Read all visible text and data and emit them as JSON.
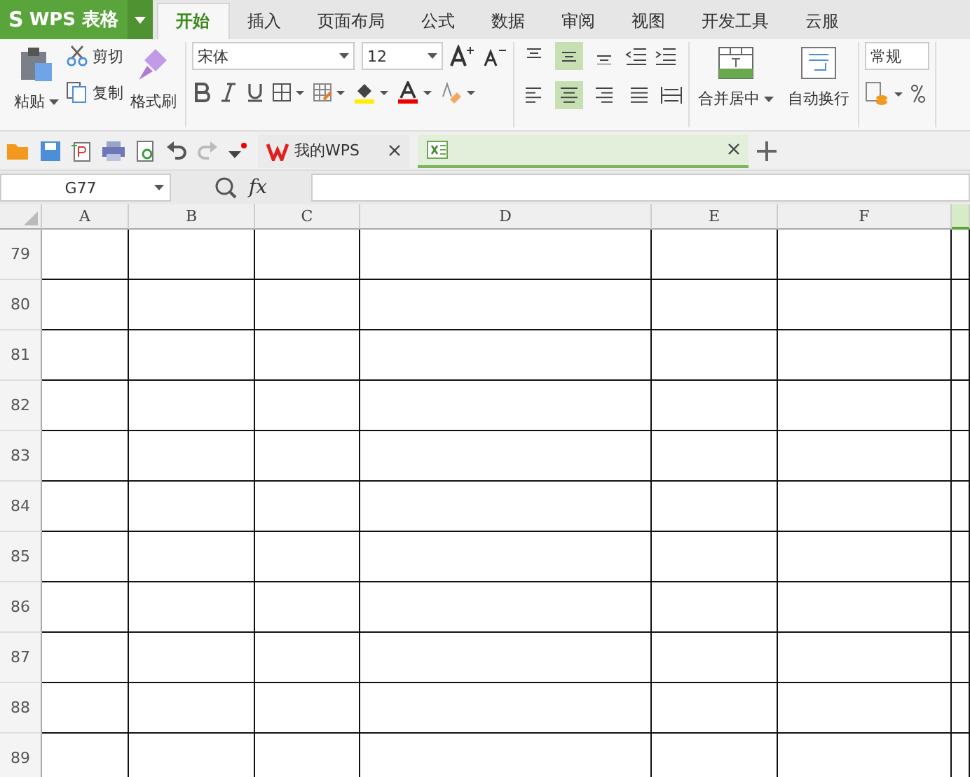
{
  "app_menu": {
    "logo": "S",
    "title": "WPS 表格"
  },
  "tabs": [
    {
      "label": "开始",
      "selected": true
    },
    {
      "label": "插入",
      "selected": false
    },
    {
      "label": "页面布局",
      "selected": false
    },
    {
      "label": "公式",
      "selected": false
    },
    {
      "label": "数据",
      "selected": false
    },
    {
      "label": "审阅",
      "selected": false
    },
    {
      "label": "视图",
      "selected": false
    },
    {
      "label": "开发工具",
      "selected": false
    },
    {
      "label": "云服",
      "selected": false
    }
  ],
  "ribbon": {
    "paste": "粘贴",
    "cut": "剪切",
    "copy": "复制",
    "format_painter": "格式刷",
    "font": "宋体",
    "font_size": "12",
    "align_top": [
      {
        "kind": "top",
        "selected": false
      },
      {
        "kind": "middle",
        "selected": true
      },
      {
        "kind": "bottom",
        "selected": false
      }
    ],
    "align_bottom": [
      {
        "kind": "left",
        "selected": false
      },
      {
        "kind": "center",
        "selected": true
      },
      {
        "kind": "right",
        "selected": false
      },
      {
        "kind": "justify",
        "selected": false
      }
    ],
    "merge": "合并居中",
    "wrap": "自动换行",
    "number_format": "常规"
  },
  "doc_tabs": [
    {
      "title": "我的WPS",
      "kind": "home",
      "selected": false
    },
    {
      "kind": "spreadsheet",
      "selected": true
    }
  ],
  "formula_bar": {
    "name_box": "G77",
    "fx": "fx"
  },
  "columns": [
    {
      "label": "A",
      "selected": false
    },
    {
      "label": "B",
      "selected": false
    },
    {
      "label": "C",
      "selected": false
    },
    {
      "label": "D",
      "selected": false
    },
    {
      "label": "E",
      "selected": false
    },
    {
      "label": "F",
      "selected": false
    },
    {
      "selected": true
    }
  ],
  "rows": [
    "79",
    "80",
    "81",
    "82",
    "83",
    "84",
    "85",
    "86",
    "87",
    "88",
    "89"
  ]
}
